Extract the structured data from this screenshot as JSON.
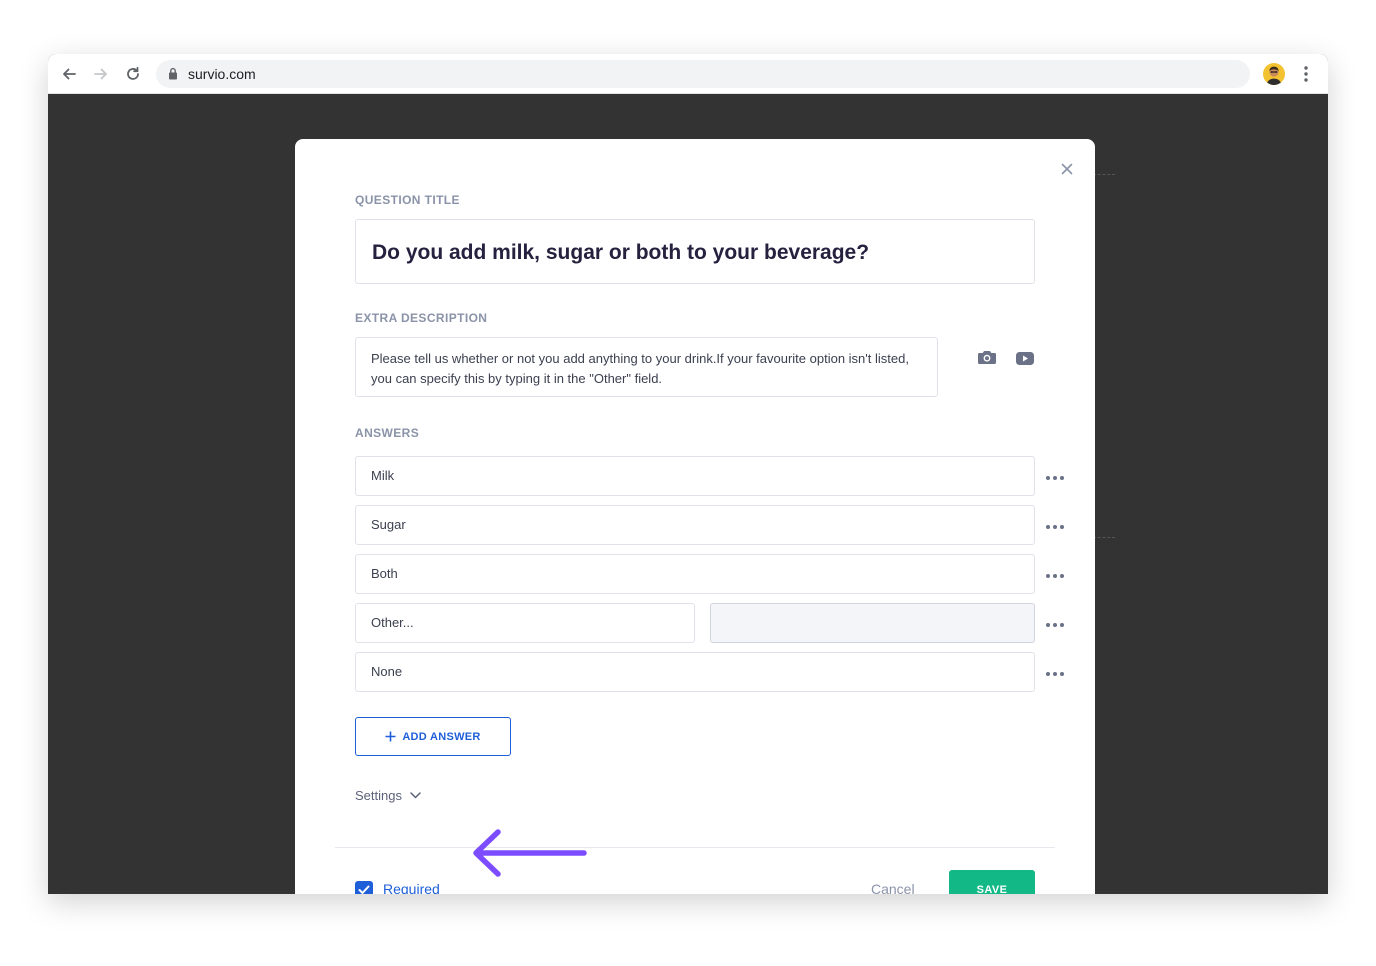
{
  "browser": {
    "url": "survio.com"
  },
  "modal": {
    "question_title_label": "QUESTION TITLE",
    "question_title": "Do you add milk, sugar or both to your beverage?",
    "extra_description_label": "EXTRA DESCRIPTION",
    "extra_description": "Please tell us whether or not you add anything to your drink.If your favourite option isn't listed, you can specify this by typing it in the \"Other\" field.",
    "answers_label": "ANSWERS",
    "answers": [
      "Milk",
      "Sugar",
      "Both",
      "Other...",
      "None"
    ],
    "add_answer_label": "ADD ANSWER",
    "settings_label": "Settings",
    "required_label": "Required",
    "required_checked": true,
    "cancel_label": "Cancel",
    "save_label": "SAVE"
  },
  "colors": {
    "accent": "#1e5fd9",
    "save": "#12b886",
    "annotation_arrow": "#7c4dff"
  },
  "icons": [
    "back-icon",
    "forward-icon",
    "reload-icon",
    "lock-icon",
    "avatar",
    "more-vert-icon",
    "close-icon",
    "camera-icon",
    "video-icon",
    "more-horiz-icon",
    "plus-icon",
    "chevron-down-icon",
    "check-icon",
    "arrow-left-icon"
  ]
}
